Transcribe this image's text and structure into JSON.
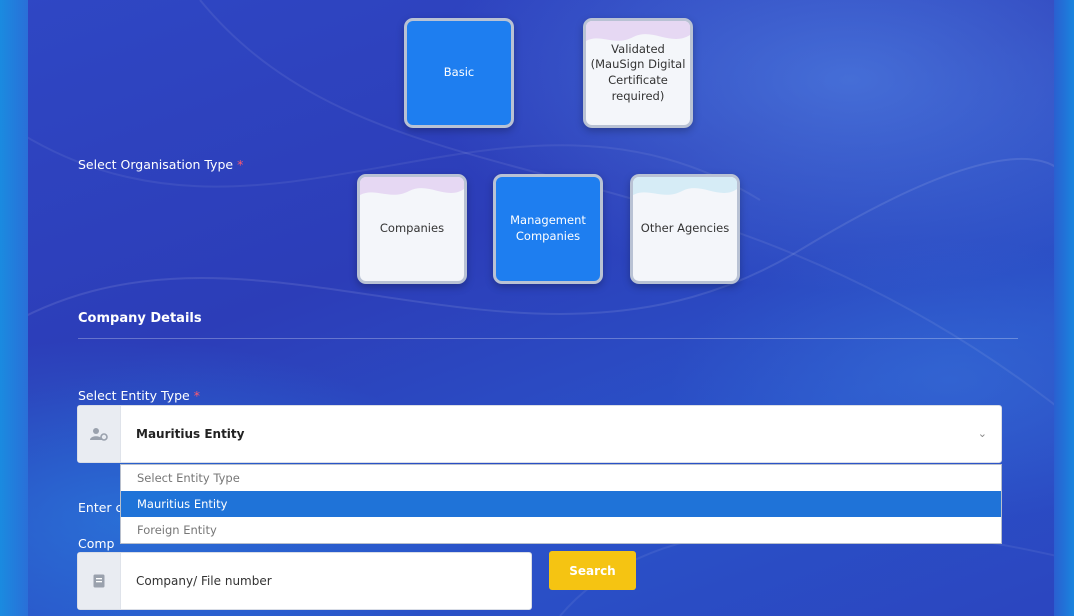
{
  "signature_types": [
    {
      "label": "Basic",
      "active": true
    },
    {
      "label": "Validated (MauSign Digital Certificate required)",
      "active": false
    }
  ],
  "organisation": {
    "label": "Select Organisation Type",
    "required_mark": "*",
    "types": [
      {
        "label": "Companies",
        "active": false
      },
      {
        "label": "Management Companies",
        "active": true
      },
      {
        "label": "Other Agencies",
        "active": false
      }
    ]
  },
  "company_details": {
    "title": "Company Details"
  },
  "entity": {
    "label": "Select Entity Type",
    "required_mark": "*",
    "selected": "Mauritius Entity",
    "icon": "user-gear-icon",
    "options": [
      {
        "label": "Select Entity Type",
        "selected": false
      },
      {
        "label": "Mauritius Entity",
        "selected": true
      },
      {
        "label": "Foreign Entity",
        "selected": false
      }
    ]
  },
  "partial_labels": {
    "enter": "Enter c",
    "company": "Comp"
  },
  "file_number": {
    "placeholder": "Company/ File number",
    "icon": "document-icon"
  },
  "search": {
    "label": "Search"
  }
}
